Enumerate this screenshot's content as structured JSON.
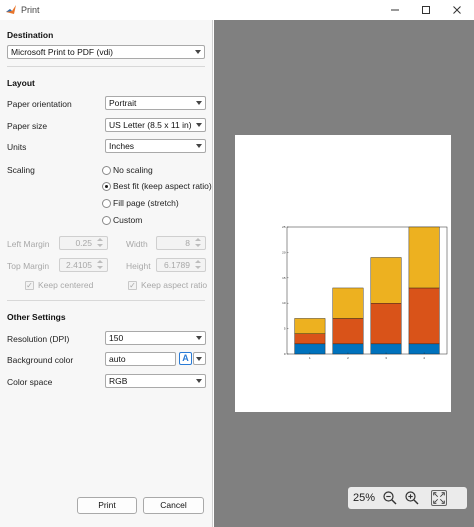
{
  "window": {
    "title": "Print"
  },
  "destination": {
    "heading": "Destination",
    "printer": "Microsoft Print to PDF (vdi)"
  },
  "layout": {
    "heading": "Layout",
    "orientation_label": "Paper orientation",
    "orientation_value": "Portrait",
    "size_label": "Paper size",
    "size_value": "US Letter (8.5 x 11 in)",
    "units_label": "Units",
    "units_value": "Inches",
    "scaling_label": "Scaling",
    "scaling_options": [
      "No scaling",
      "Best fit (keep aspect ratio)",
      "Fill page (stretch)",
      "Custom"
    ],
    "scaling_selected": "Best fit (keep aspect ratio)",
    "left_margin_label": "Left Margin",
    "left_margin_value": "0.25",
    "top_margin_label": "Top Margin",
    "top_margin_value": "2.4105",
    "width_label": "Width",
    "width_value": "8",
    "height_label": "Height",
    "height_value": "6.1789",
    "keep_centered_label": "Keep centered",
    "keep_aspect_label": "Keep aspect ratio"
  },
  "other": {
    "heading": "Other Settings",
    "resolution_label": "Resolution (DPI)",
    "resolution_value": "150",
    "bg_label": "Background color",
    "bg_value": "auto",
    "color_btn_glyph": "A",
    "colorspace_label": "Color space",
    "colorspace_value": "RGB"
  },
  "buttons": {
    "print": "Print",
    "cancel": "Cancel"
  },
  "zoom": {
    "value": "25%"
  },
  "colors": {
    "blue": "#0072BD",
    "orange": "#D95319",
    "yellow": "#EDB120"
  },
  "chart_data": {
    "type": "bar",
    "stacked": true,
    "categories": [
      "1",
      "2",
      "3",
      "4"
    ],
    "series": [
      {
        "values": [
          2,
          2,
          2,
          2
        ]
      },
      {
        "values": [
          2,
          5,
          8,
          11
        ]
      },
      {
        "values": [
          3,
          6,
          9,
          12
        ]
      }
    ],
    "ylim": [
      0,
      25
    ],
    "yticks": [
      "0",
      "5",
      "10",
      "15",
      "20",
      "25"
    ],
    "xlim": [
      0.4,
      4.6
    ],
    "grid": false
  }
}
